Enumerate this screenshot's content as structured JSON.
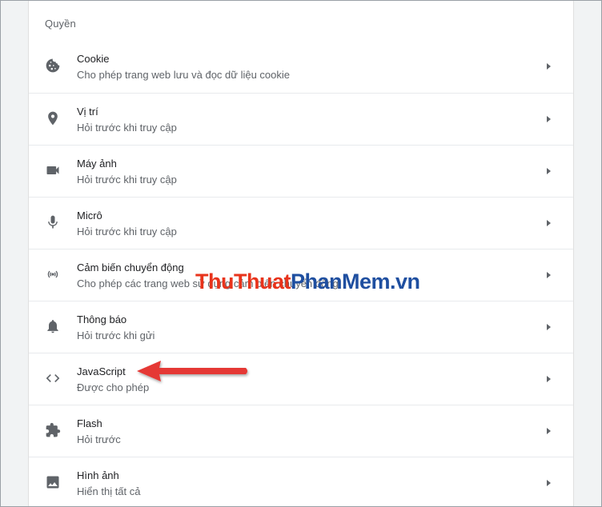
{
  "section": {
    "title": "Quyền"
  },
  "rows": [
    {
      "title": "Cookie",
      "desc": "Cho phép trang web lưu và đọc dữ liệu cookie",
      "icon": "cookie-icon"
    },
    {
      "title": "Vị trí",
      "desc": "Hỏi trước khi truy cập",
      "icon": "location-icon"
    },
    {
      "title": "Máy ảnh",
      "desc": "Hỏi trước khi truy cập",
      "icon": "camera-icon"
    },
    {
      "title": "Micrô",
      "desc": "Hỏi trước khi truy cập",
      "icon": "microphone-icon"
    },
    {
      "title": "Cảm biến chuyển động",
      "desc": "Cho phép các trang web sử dụng cảm biến chuyển động",
      "icon": "motion-sensor-icon"
    },
    {
      "title": "Thông báo",
      "desc": "Hỏi trước khi gửi",
      "icon": "bell-icon"
    },
    {
      "title": "JavaScript",
      "desc": "Được cho phép",
      "icon": "code-icon"
    },
    {
      "title": "Flash",
      "desc": "Hỏi trước",
      "icon": "puzzle-icon"
    },
    {
      "title": "Hình ảnh",
      "desc": "Hiển thị tất cả",
      "icon": "image-icon"
    }
  ],
  "watermark": {
    "part1": "ThuThuat",
    "part2": "PhanMem",
    "part3": ".vn"
  },
  "colors": {
    "accent_arrow": "#e53935",
    "watermark_red": "#e8341c",
    "watermark_blue": "#1f4fa0"
  }
}
